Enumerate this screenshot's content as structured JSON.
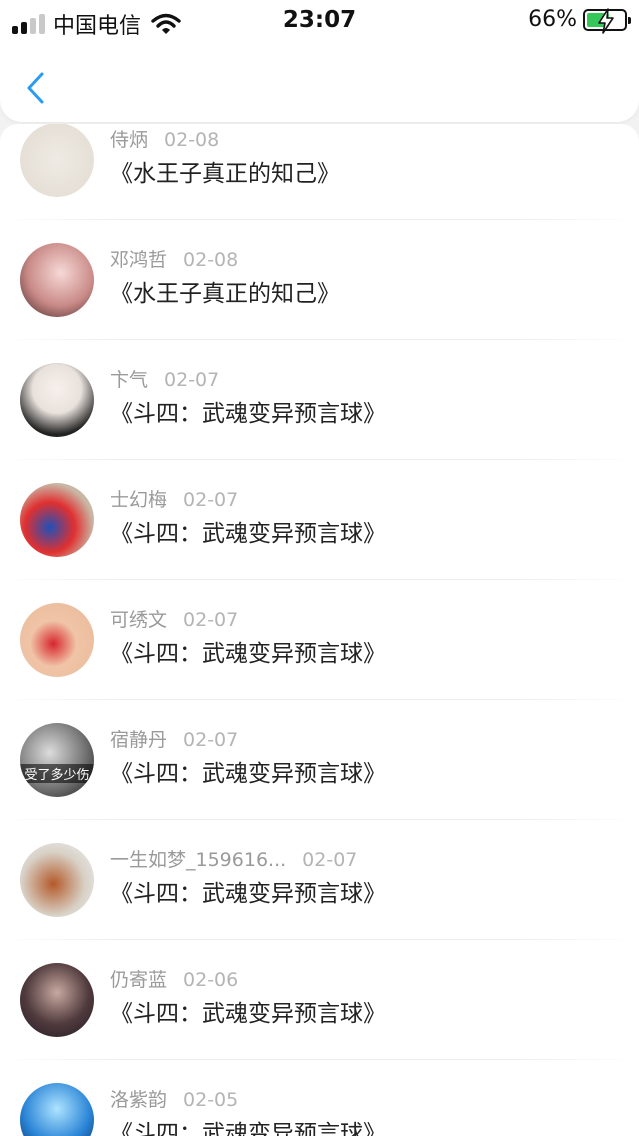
{
  "status_bar": {
    "carrier": "中国电信",
    "time": "23:07",
    "battery_percent": "66%",
    "battery_level": 0.66
  },
  "nav": {
    "back_icon": "chevron-left-icon",
    "accent_color": "#2a9bf4"
  },
  "items": [
    {
      "name": "侍炳",
      "date": "02-08",
      "text": "《水王子真正的知己》",
      "avatar_caption": ""
    },
    {
      "name": "邓鸿哲",
      "date": "02-08",
      "text": "《水王子真正的知己》",
      "avatar_caption": ""
    },
    {
      "name": "卞气",
      "date": "02-07",
      "text": "《斗四：武魂变异预言球》",
      "avatar_caption": ""
    },
    {
      "name": "士幻梅",
      "date": "02-07",
      "text": "《斗四：武魂变异预言球》",
      "avatar_caption": ""
    },
    {
      "name": "可绣文",
      "date": "02-07",
      "text": "《斗四：武魂变异预言球》",
      "avatar_caption": ""
    },
    {
      "name": "宿静丹",
      "date": "02-07",
      "text": "《斗四：武魂变异预言球》",
      "avatar_caption": "受了多少伤"
    },
    {
      "name": "一生如梦_159616...",
      "date": "02-07",
      "text": "《斗四：武魂变异预言球》",
      "avatar_caption": ""
    },
    {
      "name": "仍寄蓝",
      "date": "02-06",
      "text": "《斗四：武魂变异预言球》",
      "avatar_caption": ""
    },
    {
      "name": "洛紫韵",
      "date": "02-05",
      "text": "《斗四：武魂变异预言球》",
      "avatar_caption": ""
    }
  ]
}
